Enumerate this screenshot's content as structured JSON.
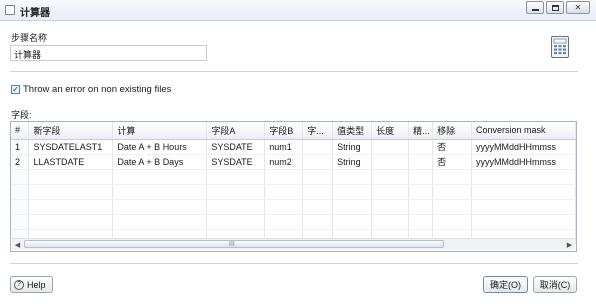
{
  "window": {
    "title": "计算器"
  },
  "step": {
    "label": "步骤名称",
    "value": "计算器"
  },
  "options": {
    "throw_error_label": "Throw an error on non existing files",
    "throw_error_checked": true
  },
  "fields": {
    "label": "字段:",
    "columns": [
      "#",
      "新字段",
      "计算",
      "字段A",
      "字段B",
      "字...",
      "值类型",
      "长度",
      "精...",
      "移除",
      "Conversion mask"
    ],
    "rows": [
      [
        "1",
        "SYSDATELAST1",
        "Date A + B Hours",
        "SYSDATE",
        "num1",
        "",
        "String",
        "",
        "",
        "否",
        "yyyyMMddHHmmss"
      ],
      [
        "2",
        "LLASTDATE",
        "Date A + B Days",
        "SYSDATE",
        "num2",
        "",
        "String",
        "",
        "",
        "否",
        "yyyyMMddHHmmss"
      ]
    ],
    "scroll_grip": "III"
  },
  "buttons": {
    "help": "Help",
    "ok": "确定(O)",
    "cancel": "取消(C)"
  }
}
